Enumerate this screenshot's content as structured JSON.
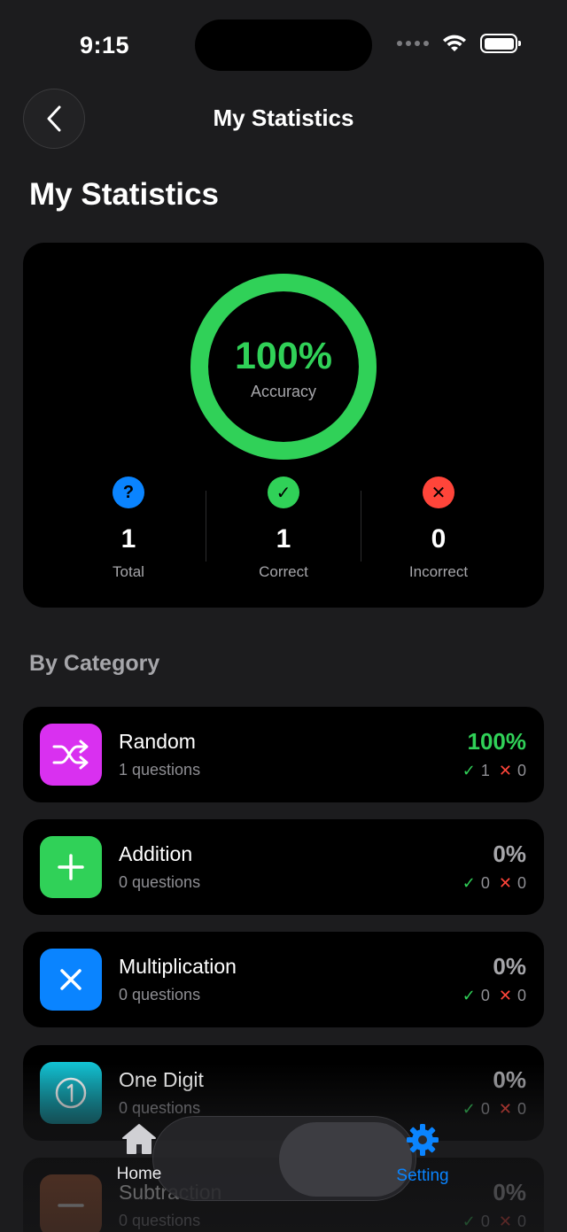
{
  "status_bar": {
    "time": "9:15"
  },
  "nav": {
    "title": "My Statistics"
  },
  "page": {
    "title": "My Statistics"
  },
  "summary": {
    "accuracy_value": "100%",
    "accuracy_fraction": 1.0,
    "accuracy_label": "Accuracy",
    "stats": [
      {
        "icon": "question-icon",
        "glyph": "?",
        "value": "1",
        "label": "Total",
        "color": "#0a84ff"
      },
      {
        "icon": "check-circle-icon",
        "glyph": "✓",
        "value": "1",
        "label": "Correct",
        "color": "#30d158"
      },
      {
        "icon": "x-circle-icon",
        "glyph": "✕",
        "value": "0",
        "label": "Incorrect",
        "color": "#ff453a"
      }
    ]
  },
  "section": {
    "title": "By Category"
  },
  "categories": [
    {
      "name": "Random",
      "sub": "1 questions",
      "pct": "100%",
      "correct": "1",
      "incorrect": "0",
      "icon": "shuffle-icon",
      "color": "#d930f0"
    },
    {
      "name": "Addition",
      "sub": "0 questions",
      "pct": "0%",
      "correct": "0",
      "incorrect": "0",
      "icon": "plus-icon",
      "color": "#30d158"
    },
    {
      "name": "Multiplication",
      "sub": "0 questions",
      "pct": "0%",
      "correct": "0",
      "incorrect": "0",
      "icon": "multiply-icon",
      "color": "#0a84ff"
    },
    {
      "name": "One Digit",
      "sub": "0 questions",
      "pct": "0%",
      "correct": "0",
      "incorrect": "0",
      "icon": "one-circle-icon",
      "color": "#12c3d4"
    },
    {
      "name": "Subtraction",
      "sub": "0 questions",
      "pct": "0%",
      "correct": "0",
      "incorrect": "0",
      "icon": "minus-icon",
      "color": "#a0522d"
    }
  ],
  "tabs": [
    {
      "label": "Home",
      "icon": "house-icon",
      "active": false
    },
    {
      "label": "Setting",
      "icon": "gear-icon",
      "active": true
    }
  ],
  "colors": {
    "accent_green": "#30d158",
    "accent_blue": "#0a84ff",
    "accent_red": "#ff453a",
    "background": "#1c1c1e",
    "card": "#000000"
  }
}
